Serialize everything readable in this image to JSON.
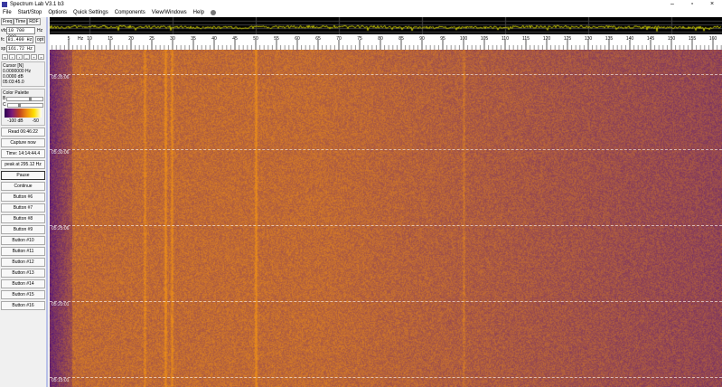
{
  "window": {
    "title": "Spectrum Lab V3.1 b3",
    "minimize": "–",
    "maximize": "▫",
    "close": "×"
  },
  "menu": [
    "File",
    "Start/Stop",
    "Options",
    "Quick Settings",
    "Components",
    "View/Windows",
    "Help"
  ],
  "left": {
    "tabs": [
      "Freq",
      "Time",
      "RDF"
    ],
    "vfo": {
      "label": "vfo",
      "value": "10 700 000",
      "unit": "Hz"
    },
    "fc": {
      "label": "fc",
      "value": "81.400 Hz",
      "button": "opt"
    },
    "sp": {
      "label": "sp",
      "value": "161.72 Hz"
    },
    "nav": [
      "«",
      "‹",
      "›",
      "–",
      "+",
      "»"
    ],
    "cursor": {
      "title": "Cursor [N]",
      "freq": "0.0000000 Hz",
      "db": "0.0000 dB",
      "time": "05:03:45.0"
    },
    "palette": {
      "title": "Color Palette",
      "b": "B",
      "c": "C",
      "min": "-100 dB",
      "max": "-50",
      "b_level": 0.75,
      "c_level": 0.35
    },
    "read": "Read 06:46:22",
    "capture": "Capture now",
    "time": "Time:  14:14:44.4",
    "peak": "peak at 295.12 Hz",
    "buttons": [
      "Pause",
      "Continue",
      "Button #6",
      "Button #7",
      "Button #8",
      "Button #9",
      "Button #10",
      "Button #11",
      "Button #12",
      "Button #13",
      "Button #14",
      "Button #15",
      "Button #16"
    ]
  },
  "scale": {
    "unit": "Hz",
    "ticks": [
      5,
      10,
      15,
      20,
      25,
      30,
      35,
      40,
      45,
      50,
      55,
      60,
      65,
      70,
      75,
      80,
      85,
      90,
      95,
      100,
      105,
      110,
      115,
      120,
      125,
      130,
      135,
      140,
      145,
      150,
      155,
      160
    ]
  },
  "waterfall": {
    "time_labels": [
      "05:35:06",
      "05:30:06",
      "05:25:06",
      "05:20:01",
      "05:15:01"
    ]
  },
  "colors": {
    "spectrum_trace": "#c8c800",
    "waterfall_low": "#5a1a80",
    "waterfall_high": "#e88a1a"
  }
}
